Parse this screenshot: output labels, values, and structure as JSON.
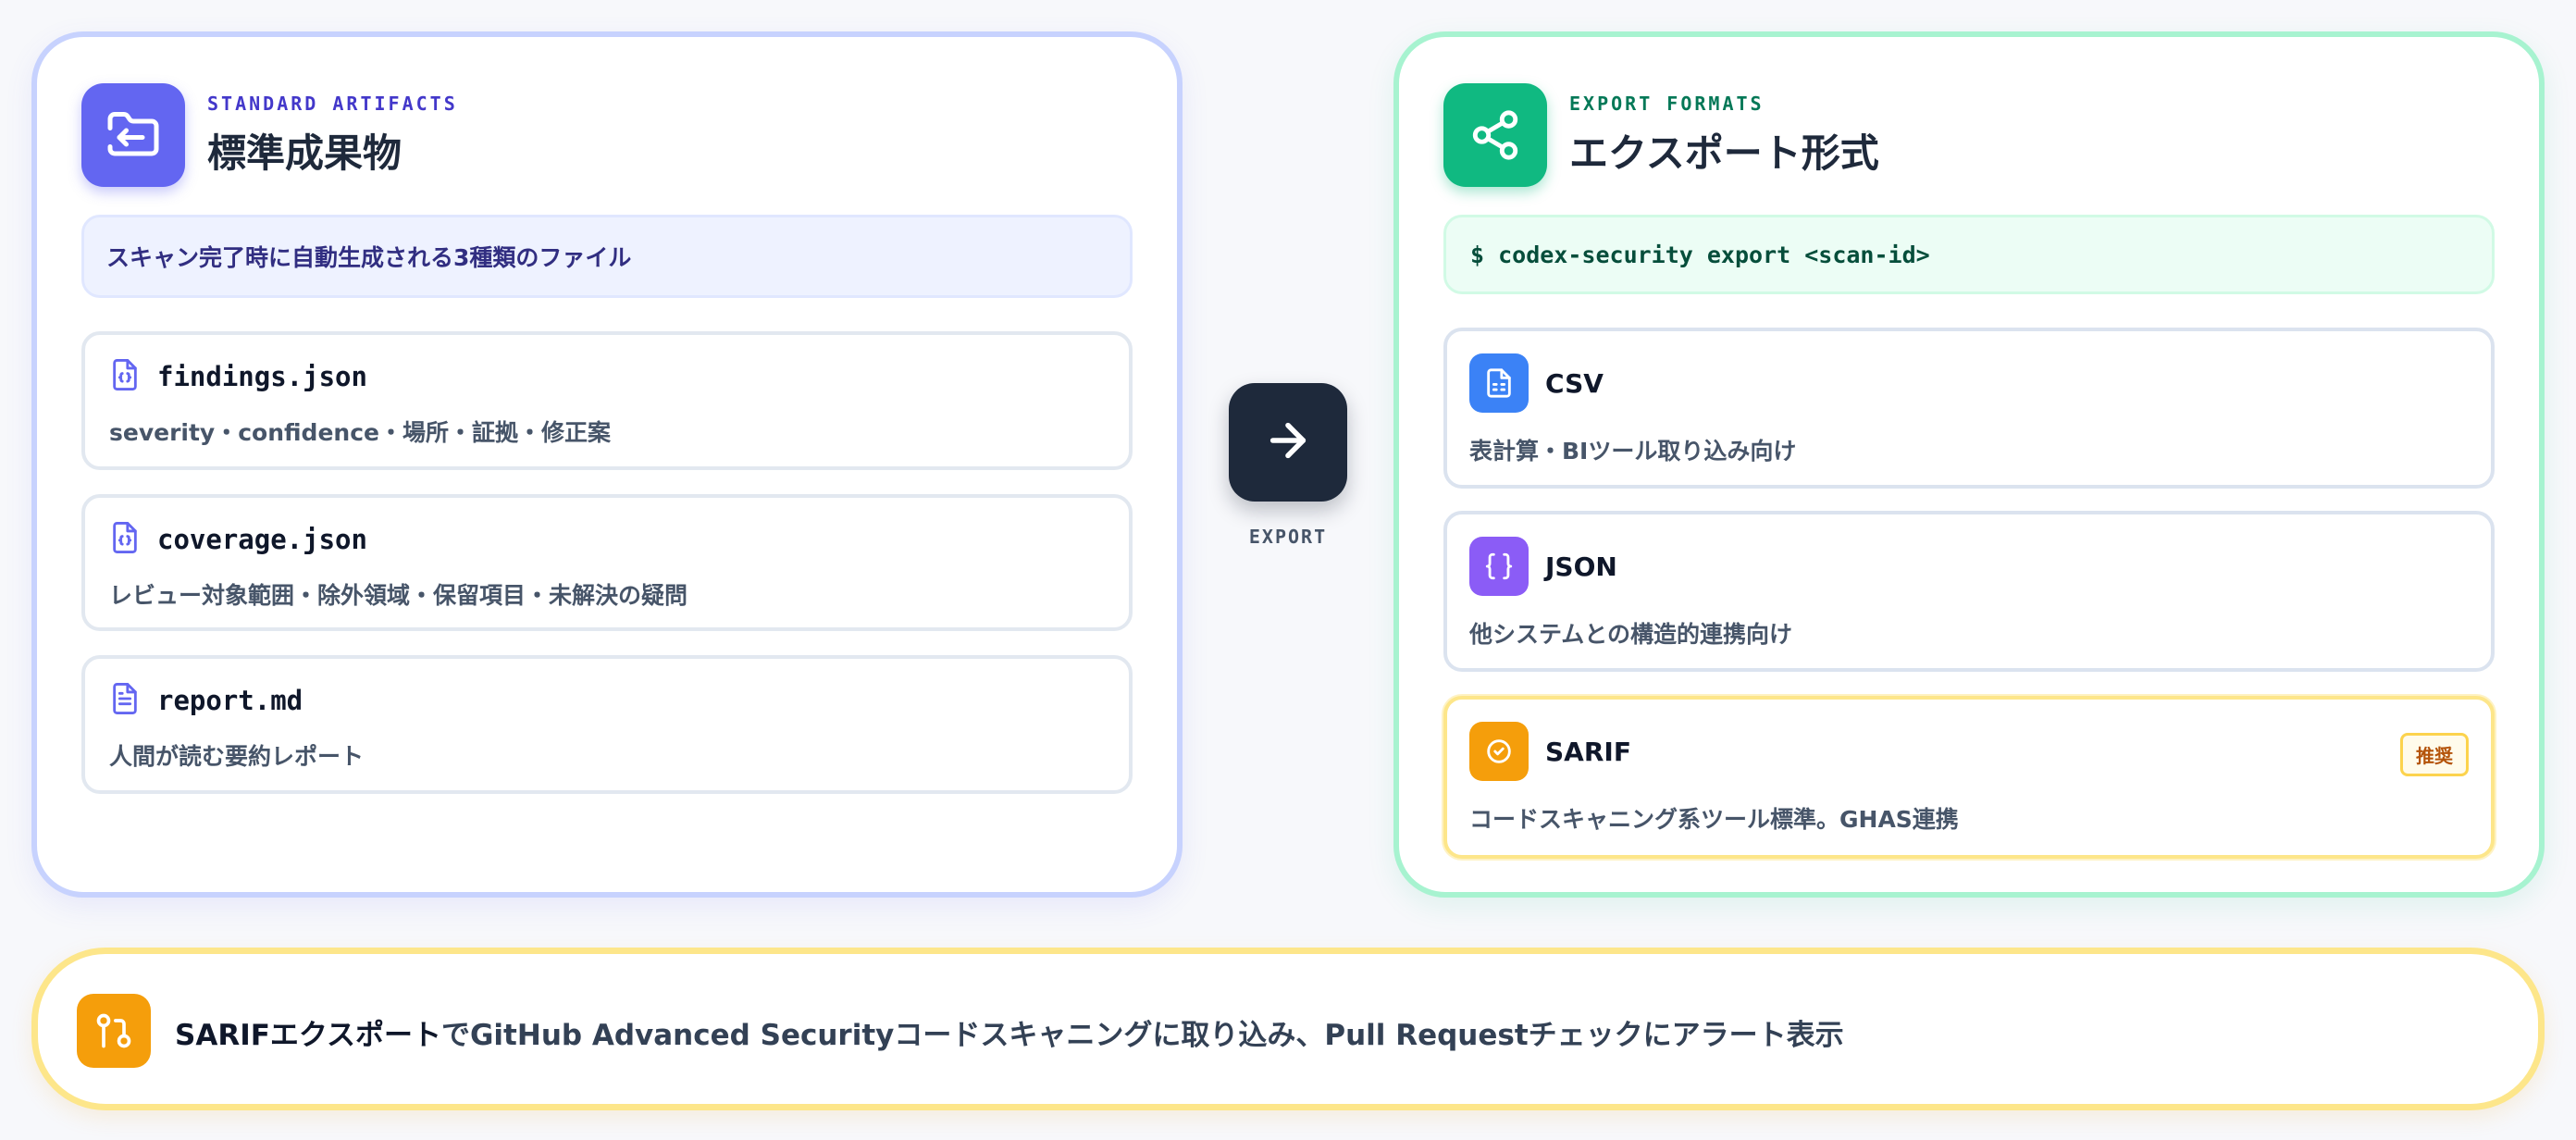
{
  "left_panel": {
    "kicker": "STANDARD ARTIFACTS",
    "title": "標準成果物",
    "icon": "folder-input-icon",
    "banner": "スキャン完了時に自動生成される3種類のファイル",
    "files": [
      {
        "name": "findings.json",
        "description": "severity・confidence・場所・証拠・修正案",
        "icon": "file-json-icon"
      },
      {
        "name": "coverage.json",
        "description": "レビュー対象範囲・除外領域・保留項目・未解決の疑問",
        "icon": "file-json-icon"
      },
      {
        "name": "report.md",
        "description": "人間が読む要約レポート",
        "icon": "file-text-icon"
      }
    ]
  },
  "connector": {
    "label": "EXPORT",
    "icon": "arrow-right-icon"
  },
  "right_panel": {
    "kicker": "EXPORT FORMATS",
    "title": "エクスポート形式",
    "icon": "share-icon",
    "command": "$ codex-security export <scan-id>",
    "formats": [
      {
        "name": "CSV",
        "description": "表計算・BIツール取り込み向け",
        "icon": "spreadsheet-file-icon",
        "color": "#3b82f6"
      },
      {
        "name": "JSON",
        "description": "他システムとの構造的連携向け",
        "icon": "braces-icon",
        "color": "#8b5cf6"
      },
      {
        "name": "SARIF",
        "description": "コードスキャニング系ツール標準。GHAS連携",
        "icon": "check-badge-icon",
        "color": "#f59e0b",
        "badge": "推奨"
      }
    ]
  },
  "bottom": {
    "icon": "git-pull-request-icon",
    "strong": "SARIFエクスポート",
    "text": "でGitHub Advanced Securityコードスキャニングに取り込み、Pull Requestチェックにアラート表示"
  },
  "colors": {
    "indigo": "#6366f1",
    "green": "#10b981",
    "amber": "#f59e0b",
    "dark": "#1e293b"
  }
}
